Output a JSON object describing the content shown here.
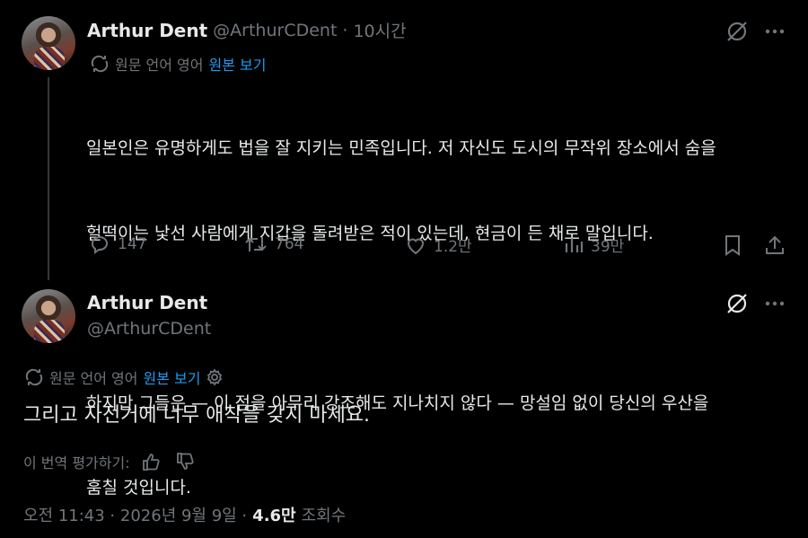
{
  "tweet1": {
    "display_name": "Arthur Dent",
    "handle": "@ArthurCDent",
    "dot": "·",
    "time": "10시간",
    "translation": {
      "prefix": "원문 언어 영어",
      "show_original": "원본 보기"
    },
    "lines": [
      "일본인은 유명하게도 법을 잘 지키는 민족입니다. 저 자신도 도시의 무작위 장소에서 숨을",
      "헐떡이는 낯선 사람에게 지갑을 돌려받은 적이 있는데, 현금이 든 채로 말입니다.",
      "하지만 그들은 — 이 점을 아무리 강조해도 지나치지 않다 — 망설임 없이 당신의 우산을",
      "훔칠 것입니다."
    ],
    "stats": {
      "replies": "147",
      "reposts": "764",
      "likes": "1.2만",
      "views": "39만"
    },
    "icons": [
      "reply-icon",
      "repost-icon",
      "like-icon",
      "views-icon",
      "bookmark-icon",
      "share-icon",
      "grok-icon",
      "more-icon"
    ]
  },
  "tweet2": {
    "display_name": "Arthur Dent",
    "handle": "@ArthurCDent",
    "translation": {
      "prefix": "원문 언어 영어",
      "show_original": "원본 보기"
    },
    "text": "그리고 자전거에 너무 애착을 갖지 마세요.",
    "rate_label": "이 번역 평가하기:",
    "timestamp": "오전 11:43 · 2026년 9월 9일 ·",
    "views_count": "4.6만",
    "views_label": "조회수"
  },
  "colors": {
    "background": "#000000",
    "text": "#e7e9ea",
    "muted": "#71767b",
    "link": "#1d9bf0",
    "line": "#333639"
  }
}
